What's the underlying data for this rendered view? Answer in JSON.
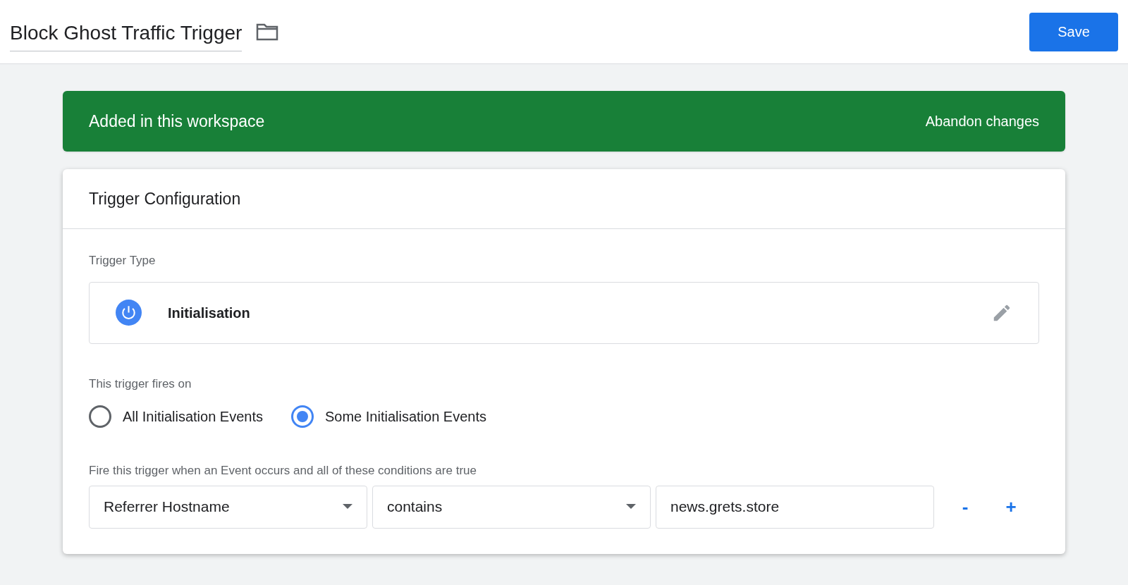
{
  "header": {
    "title": "Block Ghost Traffic Trigger",
    "save": "Save"
  },
  "banner": {
    "text": "Added in this workspace",
    "action": "Abandon changes"
  },
  "card": {
    "title": "Trigger Configuration",
    "trigger_type_label": "Trigger Type",
    "trigger_type": "Initialisation",
    "fires_on_label": "This trigger fires on",
    "fires_on": [
      {
        "label": "All Initialisation Events",
        "selected": false
      },
      {
        "label": "Some Initialisation Events",
        "selected": true
      }
    ],
    "conditions_label": "Fire this trigger when an Event occurs and all of these conditions are true",
    "condition": {
      "variable": "Referrer Hostname",
      "operator": "contains",
      "value": "news.grets.store",
      "remove": "-",
      "add": "+"
    }
  }
}
